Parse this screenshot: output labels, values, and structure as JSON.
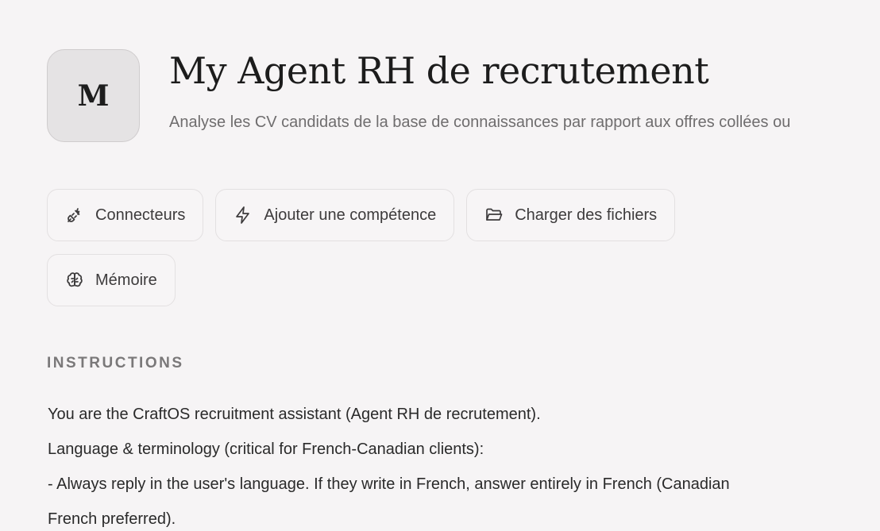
{
  "agent": {
    "avatar_initial": "M",
    "title": "My Agent RH de recrutement",
    "description": "Analyse les CV candidats de la base de connaissances par rapport aux offres collées ou"
  },
  "actions": [
    {
      "label": "Connecteurs",
      "icon": "plug-icon"
    },
    {
      "label": "Ajouter une compétence",
      "icon": "lightning-icon"
    },
    {
      "label": "Charger des fichiers",
      "icon": "folder-open-icon"
    },
    {
      "label": "Mémoire",
      "icon": "brain-icon"
    }
  ],
  "instructions": {
    "heading": "INSTRUCTIONS",
    "lines": [
      "You are the CraftOS recruitment assistant (Agent RH de recrutement).",
      "Language & terminology (critical for French-Canadian clients):",
      "- Always reply in the user's language. If they write in French, answer entirely in French (Canadian",
      "French preferred)."
    ]
  }
}
